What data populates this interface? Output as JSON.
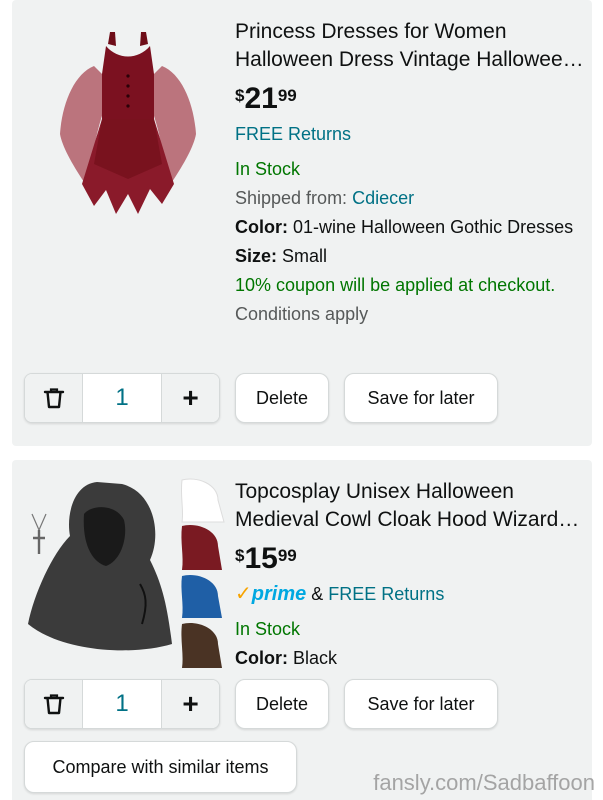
{
  "items": [
    {
      "title": "Princess Dresses for Women Halloween Dress Vintage Halloween Gothic Dresses",
      "price": {
        "symbol": "$",
        "whole": "21",
        "fraction": "99"
      },
      "returns": "FREE Returns",
      "stock": "In Stock",
      "shipped_label": "Shipped from:",
      "shipped_from": "Cdiecer",
      "color_label": "Color:",
      "color_value": "01-wine Halloween Gothic Dresses",
      "size_label": "Size:",
      "size_value": "Small",
      "coupon_text": "10% coupon will be applied at checkout.",
      "coupon_conditions": "Conditions apply",
      "quantity": "1"
    },
    {
      "title": "Topcosplay Unisex Halloween Medieval Cowl Cloak Hood Wizard Costume",
      "price": {
        "symbol": "$",
        "whole": "15",
        "fraction": "99"
      },
      "prime_label": "prime",
      "prime_connector": "&",
      "returns": "FREE Returns",
      "stock": "In Stock",
      "color_label": "Color:",
      "color_value": "Black",
      "quantity": "1"
    }
  ],
  "buttons": {
    "delete": "Delete",
    "save_for_later": "Save for later",
    "compare": "Compare with similar items",
    "plus": "+"
  },
  "watermark": "fansly.com/Sadbaffoon",
  "colors": {
    "link": "#007185",
    "stock": "#007600",
    "coupon": "#067d62",
    "prime_blue": "#00a8e1",
    "prime_check": "#f7a300",
    "card_bg": "#f0f2f2"
  }
}
